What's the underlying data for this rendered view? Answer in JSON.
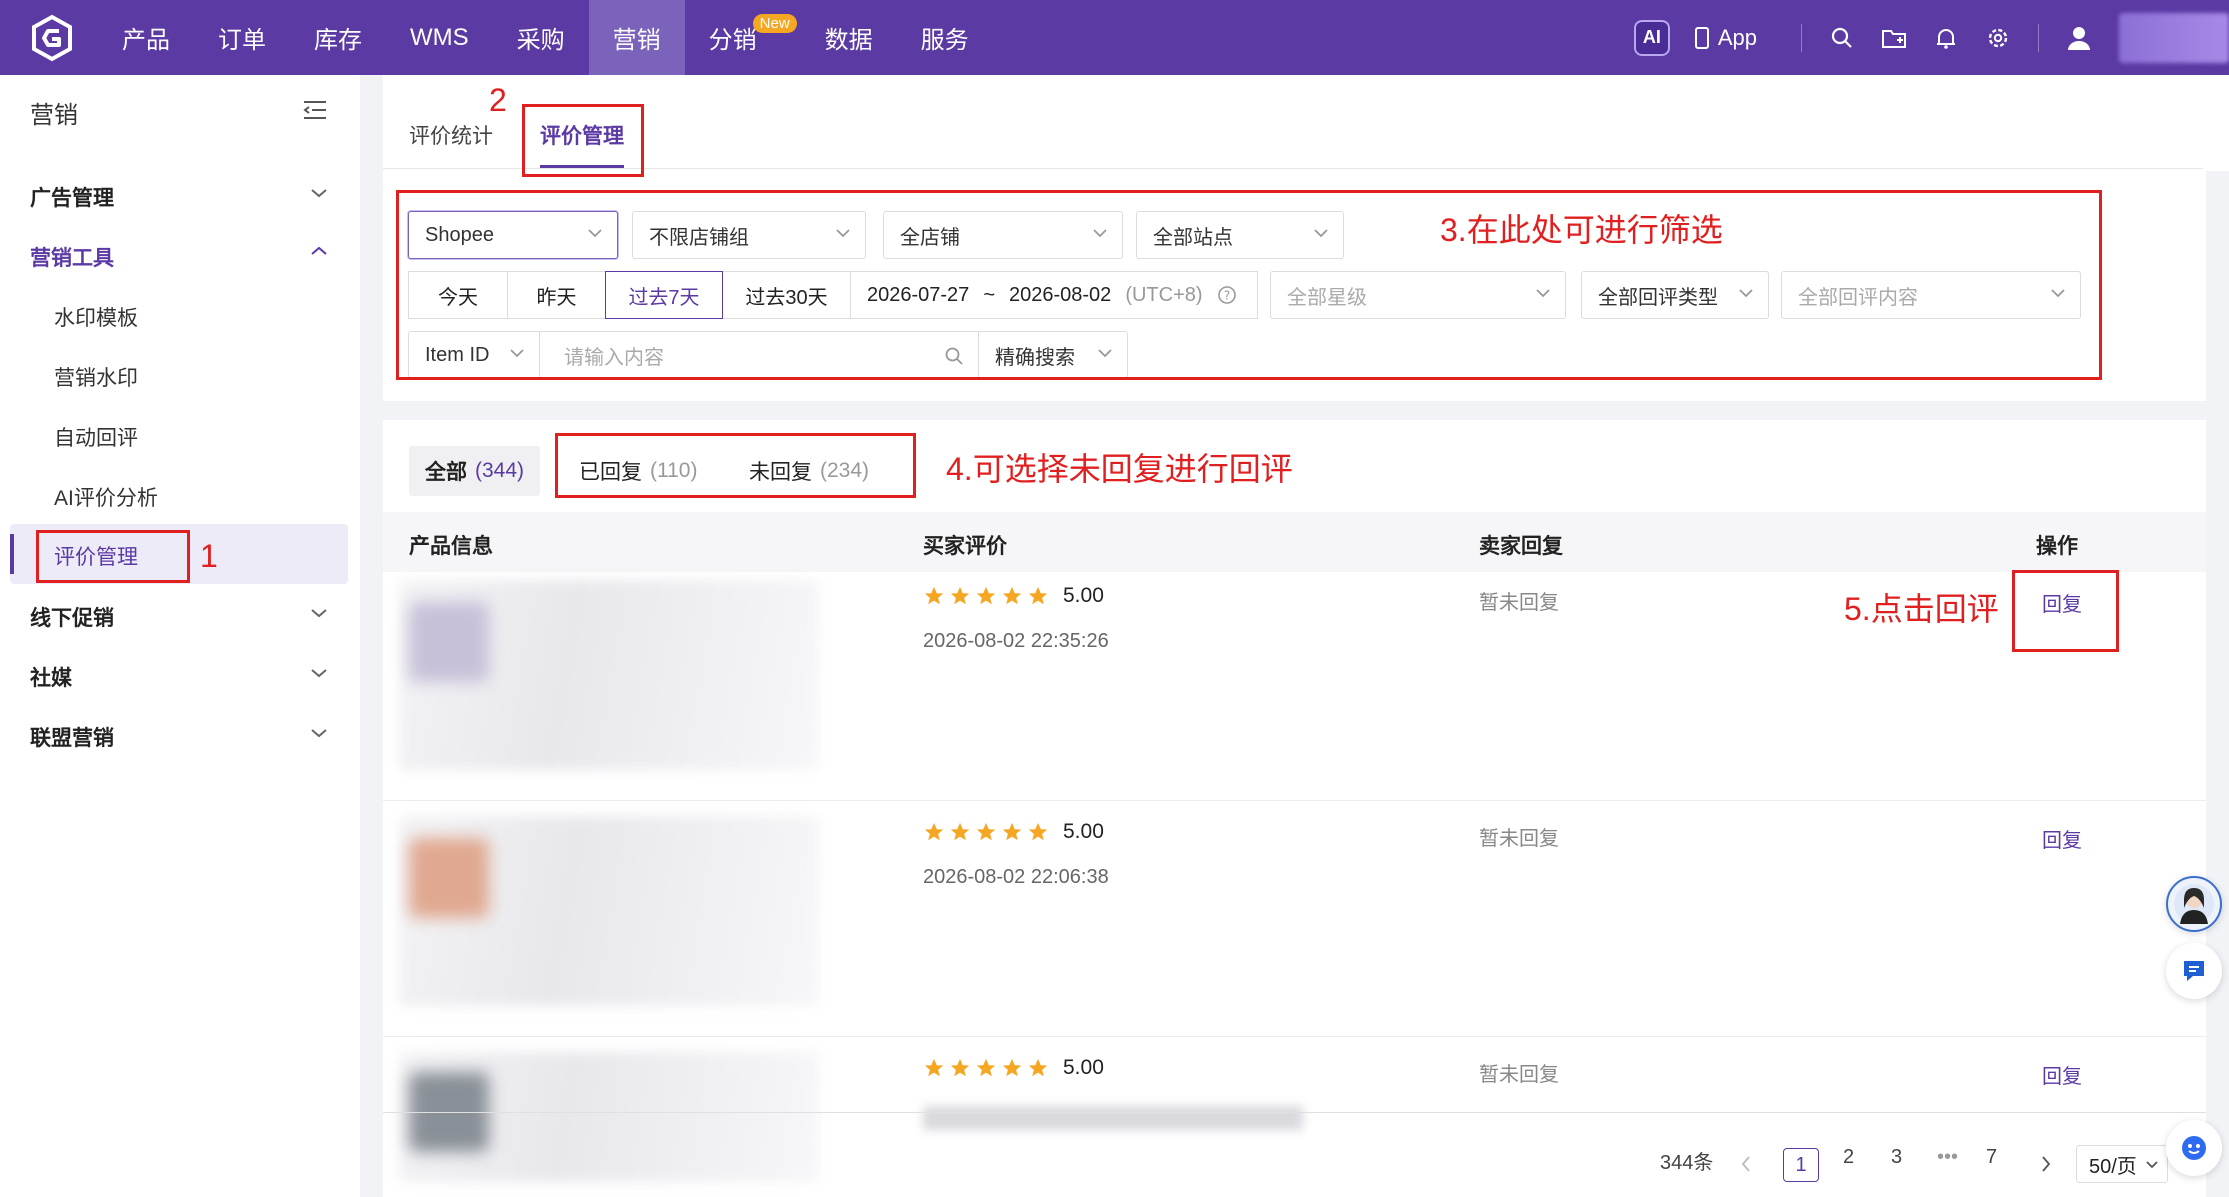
{
  "topnav": {
    "items": [
      "产品",
      "订单",
      "库存",
      "WMS",
      "采购",
      "营销",
      "分销",
      "数据",
      "服务"
    ],
    "new_badge": "New",
    "ai_label": "AI",
    "app_label": "App"
  },
  "sidebar": {
    "title": "营销",
    "groups": {
      "ads": "广告管理",
      "tools": "营销工具",
      "offline": "线下促销",
      "social": "社媒",
      "affiliate": "联盟营销"
    },
    "tool_items": [
      "水印模板",
      "营销水印",
      "自动回评",
      "AI评价分析",
      "评价管理"
    ]
  },
  "tabs": [
    "评价统计",
    "评价管理"
  ],
  "filters": {
    "platform": "Shopee",
    "shop_group": "不限店铺组",
    "shop": "全店铺",
    "site": "全部站点",
    "quick_dates": [
      "今天",
      "昨天",
      "过去7天",
      "过去30天"
    ],
    "date_start": "2026-07-27",
    "date_sep": "~",
    "date_end": "2026-08-02",
    "timezone": "(UTC+8)",
    "stars_placeholder": "全部星级",
    "reply_type": "全部回评类型",
    "reply_content_placeholder": "全部回评内容",
    "search_field": "Item ID",
    "search_placeholder": "请输入内容",
    "search_mode": "精确搜索"
  },
  "reply_tabs": [
    {
      "label": "全部",
      "count": "(344)"
    },
    {
      "label": "已回复",
      "count": "(110)"
    },
    {
      "label": "未回复",
      "count": "(234)"
    }
  ],
  "table": {
    "headers": [
      "产品信息",
      "买家评价",
      "卖家回复",
      "操作"
    ],
    "rows": [
      {
        "rating": "5.00",
        "date": "2026-08-02 22:35:26",
        "seller_reply": "暂未回复",
        "action": "回复"
      },
      {
        "rating": "5.00",
        "date": "2026-08-02 22:06:38",
        "seller_reply": "暂未回复",
        "action": "回复"
      },
      {
        "rating": "5.00",
        "date": "",
        "seller_reply": "暂未回复",
        "action": "回复"
      }
    ]
  },
  "pagination": {
    "total": "344条",
    "pages": [
      "1",
      "2",
      "3",
      "•••",
      "7"
    ],
    "page_size": "50/页"
  },
  "annotations": {
    "a1": "1",
    "a2": "2",
    "a3": "3.在此处可进行筛选",
    "a4": "4.可选择未回复进行回评",
    "a5": "5.点击回评"
  },
  "colors": {
    "brand": "#5b3aa3",
    "star": "#f5a623",
    "annotation": "#e02020"
  }
}
